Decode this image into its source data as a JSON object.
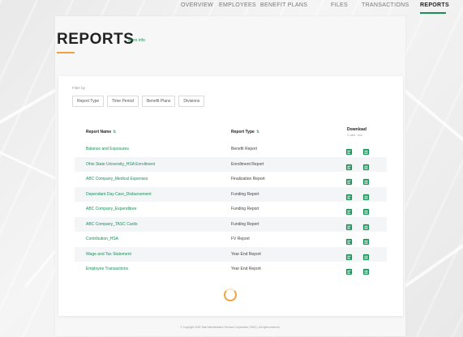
{
  "nav": {
    "items": [
      "OVERVIEW",
      "EMPLOYEES",
      "BENEFIT PLANS",
      "FILES",
      "TRANSACTIONS",
      "REPORTS"
    ],
    "active": "REPORTS",
    "accent_color": "#1b8f5a"
  },
  "header": {
    "title": "REPORTS",
    "more_info": "More info",
    "underline_color": "#f2a23c"
  },
  "filters": {
    "label": "Filter by",
    "buttons": [
      "Report Type",
      "Time Period",
      "Benefit Plans",
      "Divisions"
    ]
  },
  "table": {
    "headers": {
      "name": "Report Name",
      "type": "Report Type",
      "download": "Download",
      "download_sub": "C.sfor .xxx"
    },
    "rows": [
      {
        "name": "Balance and Exposures",
        "type": "Benefit Report"
      },
      {
        "name": "Ohio State University_HSA Enrollment",
        "type": "Enrollment Report"
      },
      {
        "name": "ABC Company_Medical Expenses",
        "type": "Finalization Report"
      },
      {
        "name": "Dependant Day Care_Disbursement",
        "type": "Funding Report"
      },
      {
        "name": "ABC Company_Expenditure",
        "type": "Funding Report"
      },
      {
        "name": "ABC Company_TASC Cards",
        "type": "Funding Report"
      },
      {
        "name": "Contribution_HSA",
        "type": "FV Report"
      },
      {
        "name": "Wage and Tax Statement",
        "type": "Year End Report"
      },
      {
        "name": "Employee Transactions",
        "type": "Year End Report"
      }
    ],
    "icons": [
      "download-csv-icon",
      "download-xls-icon"
    ]
  },
  "footer": {
    "text": "© Copyright 2018 Total Administrative Services Corporation (TASC). All rights reserved."
  }
}
